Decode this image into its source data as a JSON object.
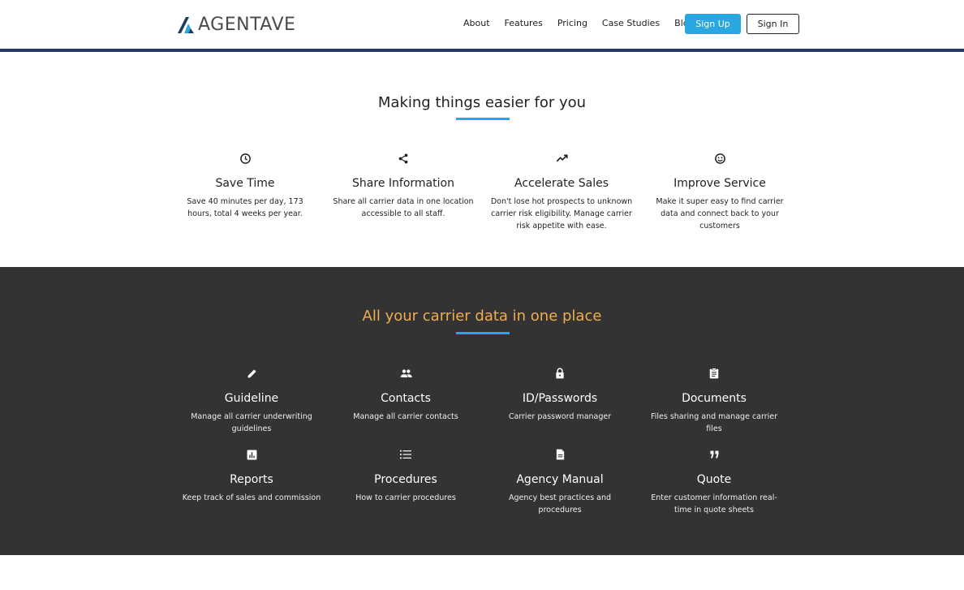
{
  "brand": {
    "name": "AGENTAVE"
  },
  "nav": {
    "links": [
      "About",
      "Features",
      "Pricing",
      "Case Studies",
      "Blog"
    ],
    "signup": "Sign Up",
    "signin": "Sign In"
  },
  "colors": {
    "accent": "#29a8e0",
    "dark_bg": "#333333",
    "highlight": "#f0ad4e",
    "nav_rule": "#1f3b61"
  },
  "section1": {
    "title": "Making things easier for you",
    "features": [
      {
        "icon": "clock-icon",
        "title": "Save Time",
        "desc": "Save 40 minutes per day, 173 hours, total 4 weeks per year."
      },
      {
        "icon": "share-icon",
        "title": "Share Information",
        "desc": "Share all carrier data in one location accessible to all staff."
      },
      {
        "icon": "trending-up-icon",
        "title": "Accelerate Sales",
        "desc": "Don't lose hot prospects to unknown carrier risk eligibility. Manage carrier risk appetite with ease."
      },
      {
        "icon": "smiley-icon",
        "title": "Improve Service",
        "desc": "Make it super easy to find carrier data and connect back to your customers"
      }
    ]
  },
  "section2": {
    "title": "All your carrier data in one place",
    "features": [
      {
        "icon": "pencil-icon",
        "title": "Guideline",
        "desc": "Manage all carrier underwriting guidelines"
      },
      {
        "icon": "people-icon",
        "title": "Contacts",
        "desc": "Manage all carrier contacts"
      },
      {
        "icon": "lock-icon",
        "title": "ID/Passwords",
        "desc": "Carrier password manager"
      },
      {
        "icon": "clipboard-icon",
        "title": "Documents",
        "desc": "Files sharing and manage carrier files"
      },
      {
        "icon": "bar-chart-icon",
        "title": "Reports",
        "desc": "Keep track of sales and commission"
      },
      {
        "icon": "list-icon",
        "title": "Procedures",
        "desc": "How to carrier procedures"
      },
      {
        "icon": "document-icon",
        "title": "Agency Manual",
        "desc": "Agency best practices and procedures"
      },
      {
        "icon": "quote-icon",
        "title": "Quote",
        "desc": "Enter customer information real-time in quote sheets"
      }
    ]
  }
}
